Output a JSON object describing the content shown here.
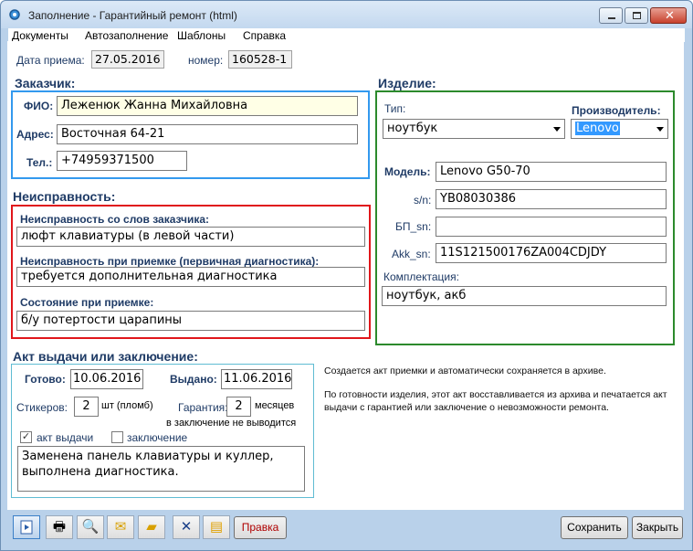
{
  "window": {
    "title": "Заполнение - Гарантийный ремонт (html)"
  },
  "menu": [
    "Документы",
    "Автозаполнение",
    "Шаблоны",
    "Справка"
  ],
  "header": {
    "date_label": "Дата приема:",
    "date_value": "27.05.2016",
    "number_label": "номер:",
    "number_value": "160528-1"
  },
  "customer": {
    "section": "Заказчик:",
    "fio_label": "ФИО:",
    "fio_value": "Леженюк Жанна Михайловна",
    "address_label": "Адрес:",
    "address_value": "Восточная 64-21",
    "phone_label": "Тел.:",
    "phone_value": "+74959371500"
  },
  "defect": {
    "section": "Неисправность:",
    "customer_words_label": "Неисправность со слов заказчика:",
    "customer_words_value": "люфт клавиатуры (в левой части)",
    "intake_label": "Неисправность при приемке (первичная диагностика):",
    "intake_value": "требуется дополнительная диагностика",
    "condition_label": "Состояние при приемке:",
    "condition_value": "б/у потертости царапины"
  },
  "product": {
    "section": "Изделие:",
    "type_label": "Тип:",
    "type_value": "ноутбук",
    "maker_label": "Производитель:",
    "maker_value": "Lenovo",
    "model_label": "Модель:",
    "model_value": "Lenovo G50-70",
    "sn_label": "s/n:",
    "sn_value": "YB08030386",
    "psu_sn_label": "БП_sn:",
    "psu_sn_value": "",
    "battery_sn_label": "Akk_sn:",
    "battery_sn_value": "11S121500176ZA004CDJDY",
    "kit_label": "Комплектация:",
    "kit_value": "ноутбук, акб"
  },
  "act": {
    "section": "Акт выдачи или заключение:",
    "ready_label": "Готово:",
    "ready_value": "10.06.2016",
    "issued_label": "Выдано:",
    "issued_value": "11.06.2016",
    "stickers_label": "Стикеров:",
    "stickers_value": "2",
    "stickers_unit": "шт (пломб)",
    "warranty_label": "Гарантия:",
    "warranty_value": "2",
    "warranty_unit": "месяцев",
    "warranty_note": "в заключение не выводится",
    "act_checkbox_label": "акт выдачи",
    "act_checked": true,
    "conclusion_checkbox_label": "заключение",
    "conclusion_checked": false,
    "text": "Заменена панель клавиатуры и куллер, выполнена диагностика."
  },
  "info": {
    "line1": "Создается акт приемки и автоматически сохраняется в архиве.",
    "line2": "По готовности изделия, этот акт восставливается из архива и печатается акт выдачи с гарантией или заключение о невозможности ремонта."
  },
  "toolbar": {
    "edit_label": "Правка",
    "save_label": "Сохранить",
    "close_label": "Закрыть"
  },
  "colors": {
    "window_frame": "#b9d1ea",
    "customer_border": "#3399ee",
    "defect_border": "#e0161b",
    "product_border": "#2c8a2c",
    "label_text": "#1f3b66"
  }
}
